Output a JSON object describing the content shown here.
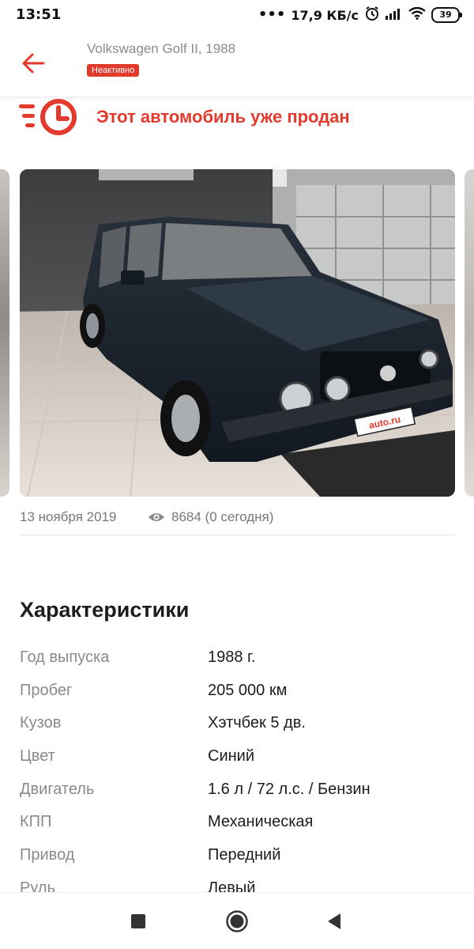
{
  "status_bar": {
    "time": "13:51",
    "dots": "•••",
    "speed": "17,9 КБ/с",
    "battery": "39"
  },
  "header": {
    "title": "Volkswagen Golf II, 1988",
    "badge": "Неактивно"
  },
  "sold_banner": {
    "text": "Этот автомобиль уже продан"
  },
  "listing": {
    "date": "13 ноября 2019",
    "views": "8684 (0 сегодня)",
    "photo_plate_text": "auto.ru"
  },
  "characteristics": {
    "title": "Характеристики",
    "rows": [
      {
        "label": "Год выпуска",
        "value": "1988 г."
      },
      {
        "label": "Пробег",
        "value": "205 000 км"
      },
      {
        "label": "Кузов",
        "value": "Хэтчбек 5 дв."
      },
      {
        "label": "Цвет",
        "value": "Синий"
      },
      {
        "label": "Двигатель",
        "value": "1.6 л / 72 л.с. / Бензин"
      },
      {
        "label": "КПП",
        "value": "Механическая"
      },
      {
        "label": "Привод",
        "value": "Передний"
      },
      {
        "label": "Руль",
        "value": "Левый"
      }
    ]
  },
  "colors": {
    "accent": "#e43a2d",
    "badge": "#e03a2c",
    "muted_text": "#8a8a8a"
  },
  "icons": {
    "back": "arrow-left-icon",
    "sold": "clock-speed-icon",
    "views": "eye-icon",
    "nav": [
      "square-icon",
      "circle-home-icon",
      "triangle-back-icon"
    ]
  }
}
